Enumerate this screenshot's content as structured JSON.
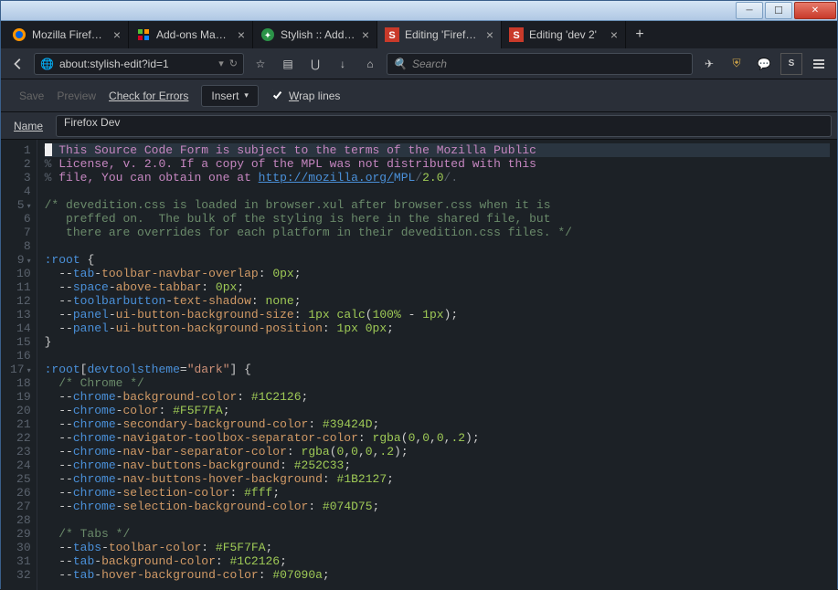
{
  "window": {
    "tabs": [
      {
        "label": "Mozilla Firefox …",
        "favicon": "firefox"
      },
      {
        "label": "Add-ons Mana…",
        "favicon": "addon"
      },
      {
        "label": "Stylish :: Add-o…",
        "favicon": "stylish-green"
      },
      {
        "label": "Editing 'Firefox …",
        "favicon": "stylish-s",
        "active": true
      },
      {
        "label": "Editing 'dev 2'",
        "favicon": "stylish-s"
      }
    ],
    "new_tab": "+"
  },
  "navbar": {
    "url": "about:stylish-edit?id=1",
    "search_placeholder": "Search"
  },
  "editorbar": {
    "save": "Save",
    "preview": "Preview",
    "check": "Check for Errors",
    "insert": "Insert",
    "wrap": "Wrap lines",
    "wrap_checked": true
  },
  "name_field": {
    "label": "Name",
    "value": "Firefox Dev"
  },
  "code": {
    "lines": [
      {
        "n": 1,
        "fold": false,
        "highlight": true,
        "tokens": [
          [
            "cursor",
            ""
          ],
          [
            "c-pct",
            "%"
          ],
          [
            "c-mag",
            " This Source Code Form is subject to the terms of the Mozilla Public"
          ]
        ]
      },
      {
        "n": 2,
        "tokens": [
          [
            "c-pct",
            "% "
          ],
          [
            "c-mag",
            "License, v. 2.0. If a copy of the MPL was not distributed with this"
          ]
        ]
      },
      {
        "n": 3,
        "tokens": [
          [
            "c-pct",
            "% "
          ],
          [
            "c-mag",
            "file, You can obtain one at "
          ],
          [
            "c-link",
            "http://mozilla.org/"
          ],
          [
            "c-link2",
            "MPL"
          ],
          [
            "c-pct",
            "/"
          ],
          [
            "c-num",
            "2.0"
          ],
          [
            "c-pct",
            "/."
          ]
        ]
      },
      {
        "n": 4,
        "tokens": []
      },
      {
        "n": 5,
        "fold": true,
        "tokens": [
          [
            "c-com",
            "/* devedition.css is loaded in browser.xul after browser.css when it is"
          ]
        ]
      },
      {
        "n": 6,
        "tokens": [
          [
            "c-com",
            "   preffed on.  The bulk of the styling is here in the shared file, but"
          ]
        ]
      },
      {
        "n": 7,
        "tokens": [
          [
            "c-com",
            "   there are overrides for each platform in their devedition.css files. */"
          ]
        ]
      },
      {
        "n": 8,
        "tokens": []
      },
      {
        "n": 9,
        "fold": true,
        "tokens": [
          [
            "c-sel",
            ":root"
          ],
          [
            "c-punc",
            " {"
          ]
        ]
      },
      {
        "n": 10,
        "tokens": [
          [
            "c-punc",
            "  --"
          ],
          [
            "c-prop1",
            "tab"
          ],
          [
            "c-punc",
            "-"
          ],
          [
            "c-prop2",
            "toolbar-navbar-overlap"
          ],
          [
            "c-punc",
            ": "
          ],
          [
            "c-num",
            "0px"
          ],
          [
            "c-punc",
            ";"
          ]
        ]
      },
      {
        "n": 11,
        "tokens": [
          [
            "c-punc",
            "  --"
          ],
          [
            "c-prop1",
            "space"
          ],
          [
            "c-punc",
            "-"
          ],
          [
            "c-prop2",
            "above-tabbar"
          ],
          [
            "c-punc",
            ": "
          ],
          [
            "c-num",
            "0px"
          ],
          [
            "c-punc",
            ";"
          ]
        ]
      },
      {
        "n": 12,
        "tokens": [
          [
            "c-punc",
            "  --"
          ],
          [
            "c-prop1",
            "toolbarbutton"
          ],
          [
            "c-punc",
            "-"
          ],
          [
            "c-prop2",
            "text-shadow"
          ],
          [
            "c-punc",
            ": "
          ],
          [
            "c-kw",
            "none"
          ],
          [
            "c-punc",
            ";"
          ]
        ]
      },
      {
        "n": 13,
        "tokens": [
          [
            "c-punc",
            "  --"
          ],
          [
            "c-prop1",
            "panel"
          ],
          [
            "c-punc",
            "-"
          ],
          [
            "c-prop2",
            "ui-button-background-size"
          ],
          [
            "c-punc",
            ": "
          ],
          [
            "c-num",
            "1px"
          ],
          [
            "c-punc",
            " "
          ],
          [
            "c-kw",
            "calc"
          ],
          [
            "c-punc",
            "("
          ],
          [
            "c-num",
            "100%"
          ],
          [
            "c-punc",
            " - "
          ],
          [
            "c-num",
            "1px"
          ],
          [
            "c-punc",
            ");"
          ]
        ]
      },
      {
        "n": 14,
        "tokens": [
          [
            "c-punc",
            "  --"
          ],
          [
            "c-prop1",
            "panel"
          ],
          [
            "c-punc",
            "-"
          ],
          [
            "c-prop2",
            "ui-button-background-position"
          ],
          [
            "c-punc",
            ": "
          ],
          [
            "c-num",
            "1px 0px"
          ],
          [
            "c-punc",
            ";"
          ]
        ]
      },
      {
        "n": 15,
        "tokens": [
          [
            "c-punc",
            "}"
          ]
        ]
      },
      {
        "n": 16,
        "tokens": []
      },
      {
        "n": 17,
        "fold": true,
        "tokens": [
          [
            "c-sel",
            ":root"
          ],
          [
            "c-punc",
            "["
          ],
          [
            "c-attr",
            "devtoolstheme"
          ],
          [
            "c-punc",
            "="
          ],
          [
            "c-str",
            "\"dark\""
          ],
          [
            "c-punc",
            "] {"
          ]
        ]
      },
      {
        "n": 18,
        "tokens": [
          [
            "c-com",
            "  /* Chrome */"
          ]
        ]
      },
      {
        "n": 19,
        "tokens": [
          [
            "c-punc",
            "  --"
          ],
          [
            "c-prop1",
            "chrome"
          ],
          [
            "c-punc",
            "-"
          ],
          [
            "c-prop2",
            "background-color"
          ],
          [
            "c-punc",
            ": "
          ],
          [
            "c-num",
            "#1C2126"
          ],
          [
            "c-punc",
            ";"
          ]
        ]
      },
      {
        "n": 20,
        "tokens": [
          [
            "c-punc",
            "  --"
          ],
          [
            "c-prop1",
            "chrome"
          ],
          [
            "c-punc",
            "-"
          ],
          [
            "c-prop2",
            "color"
          ],
          [
            "c-punc",
            ": "
          ],
          [
            "c-num",
            "#F5F7FA"
          ],
          [
            "c-punc",
            ";"
          ]
        ]
      },
      {
        "n": 21,
        "tokens": [
          [
            "c-punc",
            "  --"
          ],
          [
            "c-prop1",
            "chrome"
          ],
          [
            "c-punc",
            "-"
          ],
          [
            "c-prop2",
            "secondary-background-color"
          ],
          [
            "c-punc",
            ": "
          ],
          [
            "c-num",
            "#39424D"
          ],
          [
            "c-punc",
            ";"
          ]
        ]
      },
      {
        "n": 22,
        "tokens": [
          [
            "c-punc",
            "  --"
          ],
          [
            "c-prop1",
            "chrome"
          ],
          [
            "c-punc",
            "-"
          ],
          [
            "c-prop2",
            "navigator-toolbox-separator-color"
          ],
          [
            "c-punc",
            ": "
          ],
          [
            "c-kw",
            "rgba"
          ],
          [
            "c-punc",
            "("
          ],
          [
            "c-num",
            "0"
          ],
          [
            "c-punc",
            ","
          ],
          [
            "c-num",
            "0"
          ],
          [
            "c-punc",
            ","
          ],
          [
            "c-num",
            "0"
          ],
          [
            "c-punc",
            ","
          ],
          [
            "c-num",
            ".2"
          ],
          [
            "c-punc",
            ");"
          ]
        ]
      },
      {
        "n": 23,
        "tokens": [
          [
            "c-punc",
            "  --"
          ],
          [
            "c-prop1",
            "chrome"
          ],
          [
            "c-punc",
            "-"
          ],
          [
            "c-prop2",
            "nav-bar-separator-color"
          ],
          [
            "c-punc",
            ": "
          ],
          [
            "c-kw",
            "rgba"
          ],
          [
            "c-punc",
            "("
          ],
          [
            "c-num",
            "0"
          ],
          [
            "c-punc",
            ","
          ],
          [
            "c-num",
            "0"
          ],
          [
            "c-punc",
            ","
          ],
          [
            "c-num",
            "0"
          ],
          [
            "c-punc",
            ","
          ],
          [
            "c-num",
            ".2"
          ],
          [
            "c-punc",
            ");"
          ]
        ]
      },
      {
        "n": 24,
        "tokens": [
          [
            "c-punc",
            "  --"
          ],
          [
            "c-prop1",
            "chrome"
          ],
          [
            "c-punc",
            "-"
          ],
          [
            "c-prop2",
            "nav-buttons-background"
          ],
          [
            "c-punc",
            ": "
          ],
          [
            "c-num",
            "#252C33"
          ],
          [
            "c-punc",
            ";"
          ]
        ]
      },
      {
        "n": 25,
        "tokens": [
          [
            "c-punc",
            "  --"
          ],
          [
            "c-prop1",
            "chrome"
          ],
          [
            "c-punc",
            "-"
          ],
          [
            "c-prop2",
            "nav-buttons-hover-background"
          ],
          [
            "c-punc",
            ": "
          ],
          [
            "c-num",
            "#1B2127"
          ],
          [
            "c-punc",
            ";"
          ]
        ]
      },
      {
        "n": 26,
        "tokens": [
          [
            "c-punc",
            "  --"
          ],
          [
            "c-prop1",
            "chrome"
          ],
          [
            "c-punc",
            "-"
          ],
          [
            "c-prop2",
            "selection-color"
          ],
          [
            "c-punc",
            ": "
          ],
          [
            "c-num",
            "#fff"
          ],
          [
            "c-punc",
            ";"
          ]
        ]
      },
      {
        "n": 27,
        "tokens": [
          [
            "c-punc",
            "  --"
          ],
          [
            "c-prop1",
            "chrome"
          ],
          [
            "c-punc",
            "-"
          ],
          [
            "c-prop2",
            "selection-background-color"
          ],
          [
            "c-punc",
            ": "
          ],
          [
            "c-num",
            "#074D75"
          ],
          [
            "c-punc",
            ";"
          ]
        ]
      },
      {
        "n": 28,
        "tokens": []
      },
      {
        "n": 29,
        "tokens": [
          [
            "c-com",
            "  /* Tabs */"
          ]
        ]
      },
      {
        "n": 30,
        "tokens": [
          [
            "c-punc",
            "  --"
          ],
          [
            "c-prop1",
            "tabs"
          ],
          [
            "c-punc",
            "-"
          ],
          [
            "c-prop2",
            "toolbar-color"
          ],
          [
            "c-punc",
            ": "
          ],
          [
            "c-num",
            "#F5F7FA"
          ],
          [
            "c-punc",
            ";"
          ]
        ]
      },
      {
        "n": 31,
        "tokens": [
          [
            "c-punc",
            "  --"
          ],
          [
            "c-prop1",
            "tab"
          ],
          [
            "c-punc",
            "-"
          ],
          [
            "c-prop2",
            "background-color"
          ],
          [
            "c-punc",
            ": "
          ],
          [
            "c-num",
            "#1C2126"
          ],
          [
            "c-punc",
            ";"
          ]
        ]
      },
      {
        "n": 32,
        "tokens": [
          [
            "c-punc",
            "  --"
          ],
          [
            "c-prop1",
            "tab"
          ],
          [
            "c-punc",
            "-"
          ],
          [
            "c-prop2",
            "hover-background-color"
          ],
          [
            "c-punc",
            ": "
          ],
          [
            "c-num",
            "#07090a"
          ],
          [
            "c-punc",
            ";"
          ]
        ]
      }
    ]
  }
}
